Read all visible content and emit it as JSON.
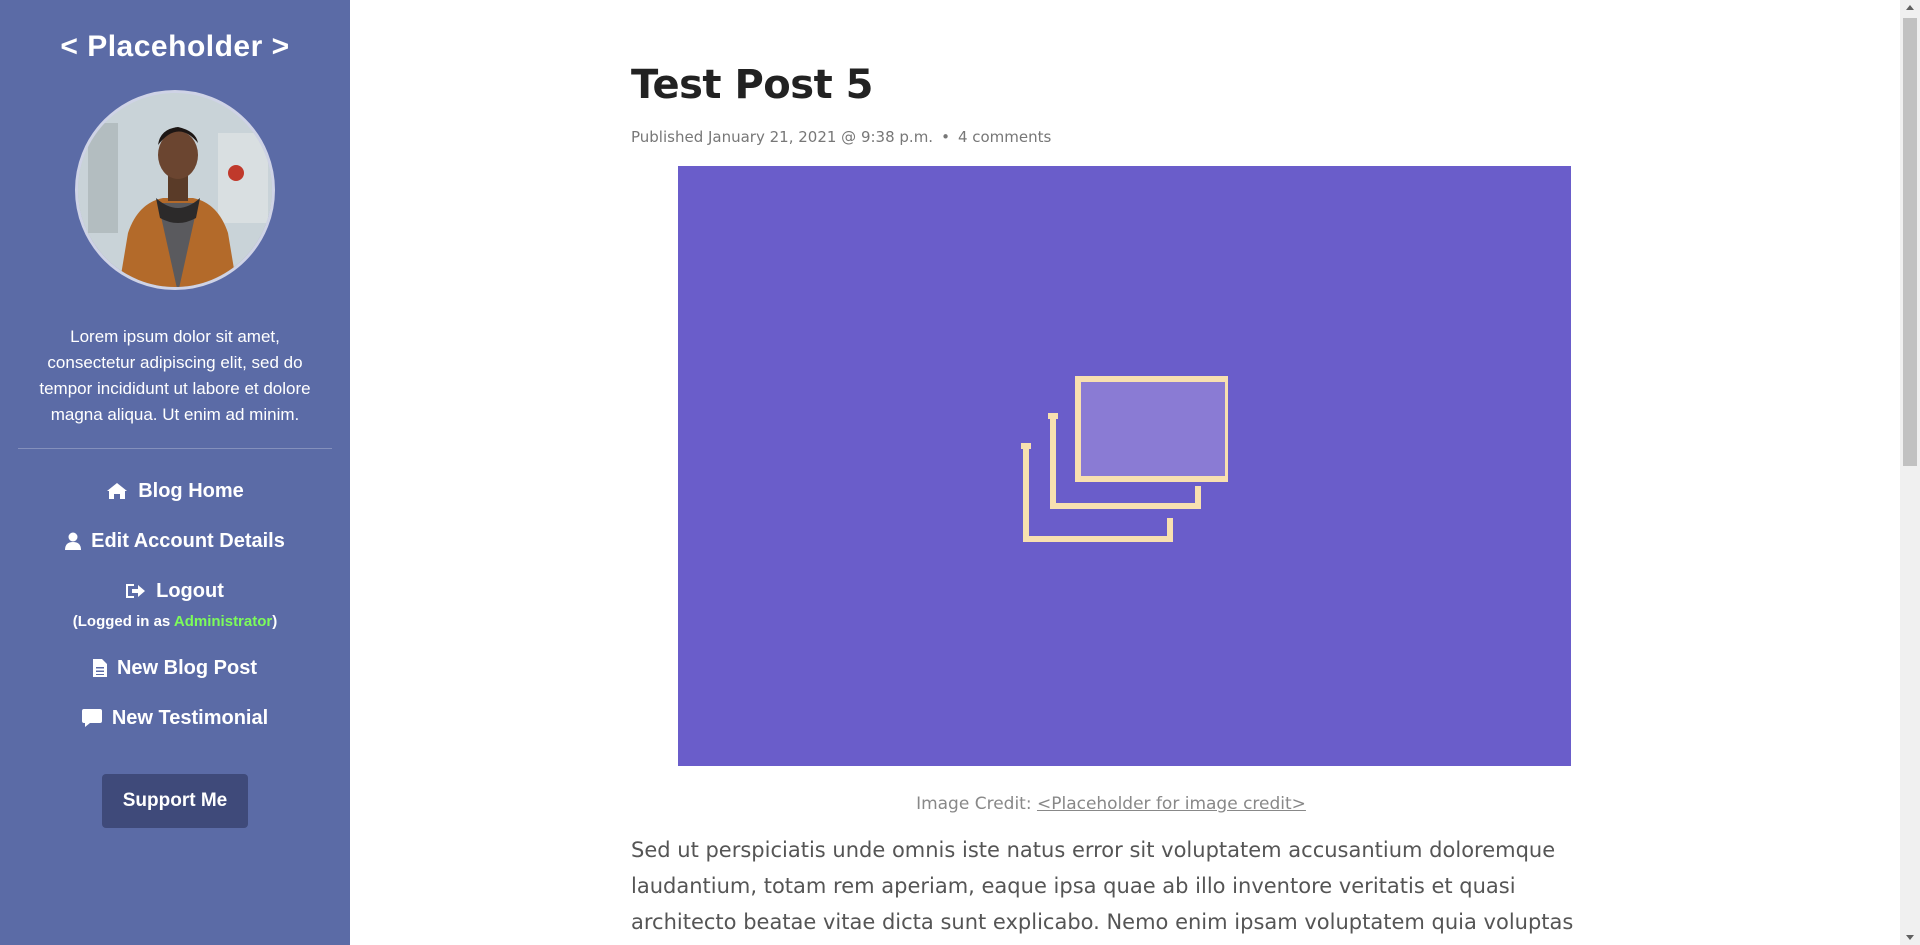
{
  "sidebar": {
    "site_title": "< Placeholder >",
    "bio": "Lorem ipsum dolor sit amet, consectetur adipiscing elit, sed do tempor incididunt ut labore et dolore magna aliqua. Ut enim ad minim.",
    "nav": {
      "blog_home": "Blog Home",
      "edit_account": "Edit Account Details",
      "logout": "Logout",
      "logged_in_prefix": "(Logged in as ",
      "logged_in_role": "Administrator",
      "logged_in_suffix": ")",
      "new_blog_post": "New Blog Post",
      "new_testimonial": "New Testimonial"
    },
    "support_button": "Support Me",
    "colors": {
      "background": "#5b6ba6",
      "role_highlight": "#7cfc5a",
      "button": "#3f4a7a"
    }
  },
  "post": {
    "title": "Test Post 5",
    "published": "Published January 21, 2021 @ 9:38 p.m.",
    "separator": "•",
    "comments": "4 comments",
    "image_credit_label": "Image Credit:",
    "image_credit_link": "<Placeholder for image credit>",
    "body": "Sed ut perspiciatis unde omnis iste natus error sit voluptatem accusantium doloremque laudantium, totam rem aperiam, eaque ipsa quae ab illo inventore veritatis et quasi architecto beatae vitae dicta sunt explicabo. Nemo enim ipsam voluptatem quia voluptas sit aspernatur aut"
  },
  "icons": {
    "blog_home": "home-icon",
    "edit_account": "user-icon",
    "logout": "sign-out-icon",
    "new_blog_post": "file-icon",
    "new_testimonial": "comment-icon",
    "hero": "image-gallery-icon"
  },
  "hero": {
    "background": "#6a5dca",
    "icon_color": "#f8e0b0"
  }
}
